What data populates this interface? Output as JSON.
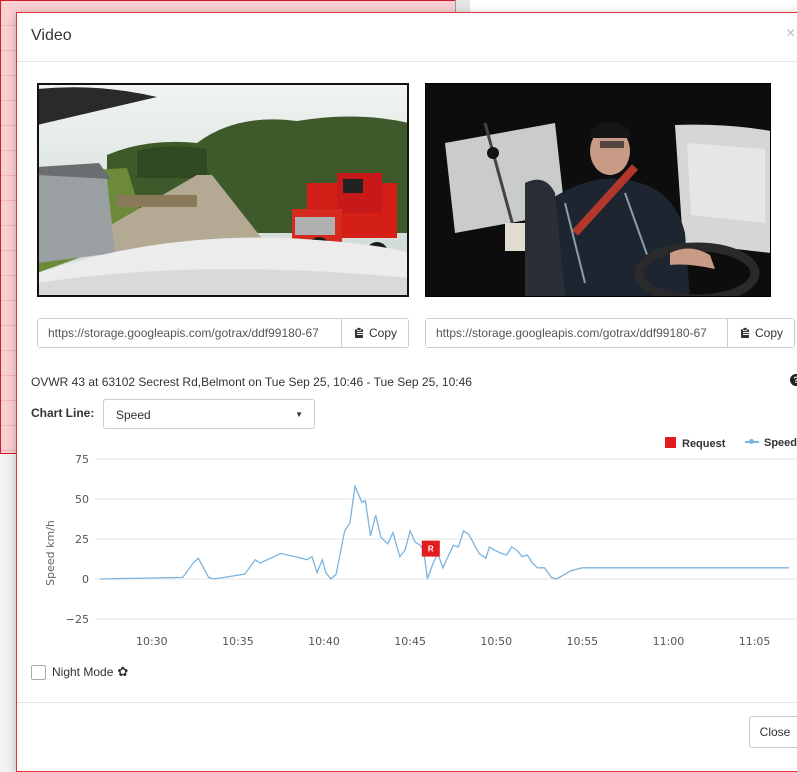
{
  "modal": {
    "title": "Video",
    "close_icon": "×",
    "videos": [
      {
        "name": "road-camera",
        "url": "https://storage.googleapis.com/gotrax/ddf99180-67",
        "copy_label": "Copy"
      },
      {
        "name": "driver-camera",
        "url": "https://storage.googleapis.com/gotrax/ddf99180-67",
        "copy_label": "Copy"
      }
    ],
    "trip_info": "OVWR 43 at 63102 Secrest Rd,Belmont on Tue Sep 25, 10:46 - Tue Sep 25, 10:46",
    "info_icon": "?",
    "chart_line_label": "Chart Line:",
    "chart_line_selected": "Speed",
    "night_mode_label": "Night Mode",
    "close_button": "Close"
  },
  "colors": {
    "accent_red": "#e31d1d",
    "series_blue": "#7cb4de",
    "modal_border": "#dd3333"
  },
  "icons": {
    "copy": "clipboard-icon",
    "settings": "gear-icon",
    "info": "info-circle-icon",
    "close": "close-icon",
    "dropdown": "caret-down-icon"
  },
  "chart_data": {
    "type": "line",
    "ylabel": "Speed km/h",
    "ylim": [
      -25,
      75
    ],
    "yticks": [
      75,
      50,
      25,
      0,
      -25
    ],
    "xticks": [
      "10:30",
      "10:35",
      "10:40",
      "10:45",
      "10:50",
      "10:55",
      "11:00",
      "11:05"
    ],
    "xlim": [
      "10:26.7",
      "11:07.0"
    ],
    "grid": true,
    "legend_position": "top-right",
    "series": [
      {
        "name": "Speed",
        "x": [
          "10:27.0",
          "10:31.8",
          "10:32.4",
          "10:32.7",
          "10:33.3",
          "10:33.6",
          "10:35.4",
          "10:36.0",
          "10:36.3",
          "10:36.9",
          "10:37.5",
          "10:38.7",
          "10:39.0",
          "10:39.3",
          "10:39.6",
          "10:39.9",
          "10:40.1",
          "10:40.4",
          "10:40.7",
          "10:41.2",
          "10:41.5",
          "10:41.8",
          "10:42.2",
          "10:42.4",
          "10:42.7",
          "10:43.0",
          "10:43.3",
          "10:43.7",
          "10:44.0",
          "10:44.4",
          "10:44.7",
          "10:45.0",
          "10:45.3",
          "10:45.6",
          "10:45.8",
          "10:46.0",
          "10:46.3",
          "10:46.6",
          "10:46.9",
          "10:47.2",
          "10:47.5",
          "10:47.8",
          "10:48.1",
          "10:48.4",
          "10:48.7",
          "10:49.0",
          "10:49.4",
          "10:49.6",
          "10:49.9",
          "10:50.3",
          "10:50.6",
          "10:50.9",
          "10:51.2",
          "10:51.5",
          "10:51.8",
          "10:52.1",
          "10:52.4",
          "10:52.8",
          "10:53.2",
          "10:53.5",
          "10:54.0",
          "10:54.3",
          "10:55.0",
          "10:55.5",
          "11:07.0"
        ],
        "y": [
          0,
          1,
          10,
          13,
          1,
          0,
          3,
          12,
          10,
          13,
          16,
          13,
          12,
          14,
          4,
          12,
          4,
          0,
          3,
          30,
          35,
          58,
          48,
          49,
          27,
          40,
          26,
          22,
          29,
          14,
          18,
          30,
          23,
          21,
          17,
          0,
          9,
          16,
          7,
          14,
          21,
          20,
          30,
          28,
          22,
          16,
          13,
          20,
          18,
          16,
          15,
          20,
          18,
          14,
          15,
          10,
          7,
          7,
          1,
          0,
          3,
          5,
          7,
          7,
          7
        ]
      }
    ],
    "markers": [
      {
        "name": "Request",
        "label": "R",
        "x": "10:46.2",
        "y": 19
      }
    ]
  }
}
